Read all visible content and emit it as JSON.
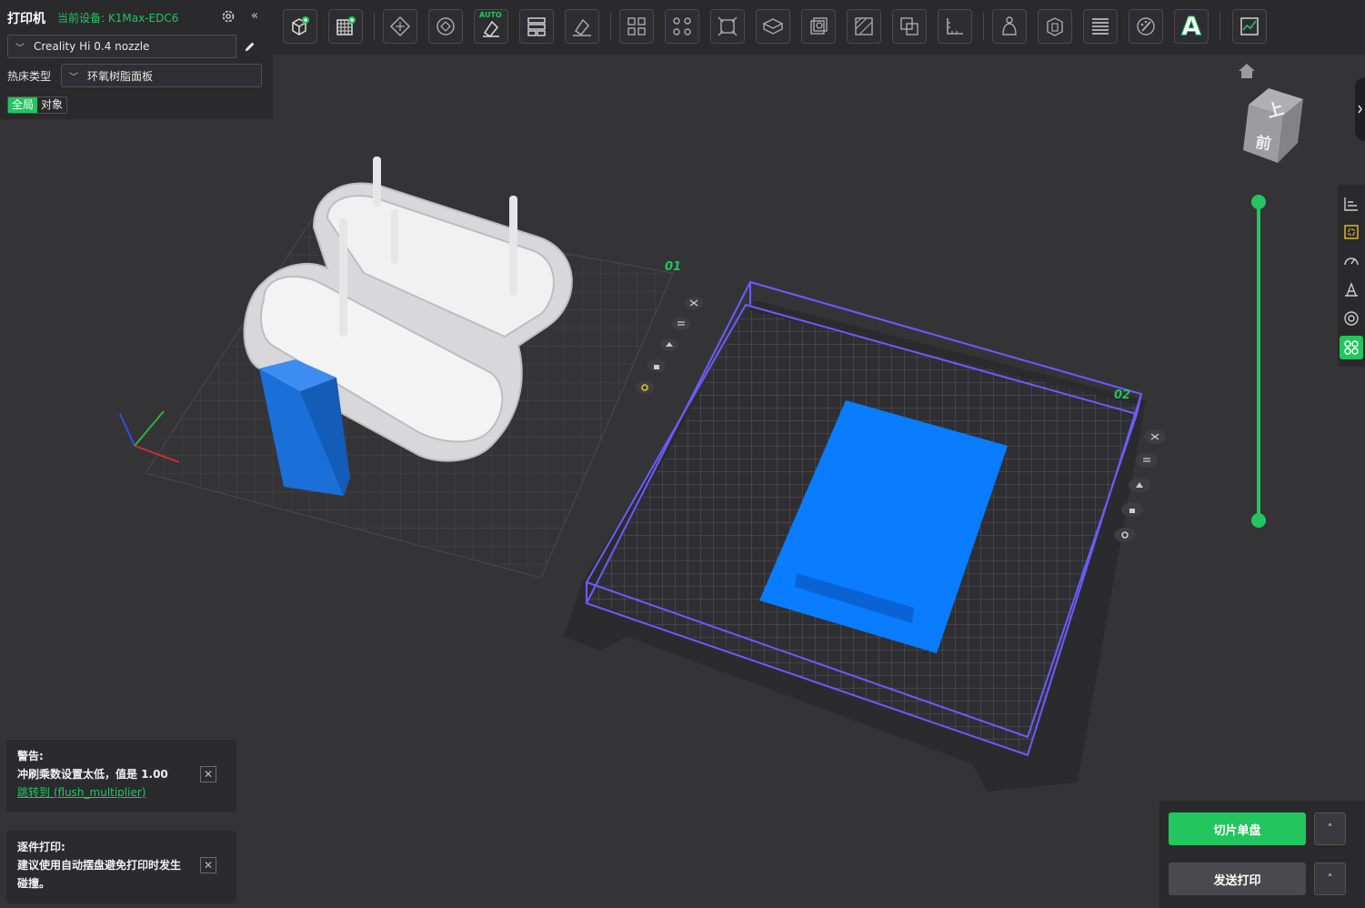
{
  "printer_panel": {
    "title": "打印机",
    "current_device": "当前设备: K1Max-EDC6",
    "collapse_glyph": "«",
    "printer_select": "Creality Hi 0.4 nozzle",
    "bed_type_label": "热床类型",
    "bed_type_value": "环氧树脂面板",
    "scope_tabs": [
      "全局",
      "对象"
    ],
    "active_scope": "全局"
  },
  "toolbar": {
    "auto_tag": "AUTO",
    "text_tool_glyph": "A",
    "icons": [
      "add-object-icon",
      "add-plate-icon",
      "arrange-icon",
      "orient-icon",
      "auto-orient-icon",
      "layout-icon",
      "lay-on-face-icon",
      "split-objects-icon",
      "split-parts-icon",
      "scale-icon",
      "hollow-icon",
      "cut-icon",
      "support-paint-icon",
      "boolean-icon",
      "measure-icon",
      "seam-paint-icon",
      "variable-layer-icon",
      "layer-icon",
      "color-paint-icon",
      "text-icon",
      "assembly-view-icon"
    ]
  },
  "plates": [
    {
      "label": "01",
      "icons": [
        "close-icon",
        "menu-icon",
        "orient-icon",
        "lock-icon",
        "settings-icon"
      ]
    },
    {
      "label": "02",
      "icons": [
        "close-icon",
        "menu-icon",
        "orient-icon",
        "lock-icon",
        "settings-icon"
      ]
    }
  ],
  "view_cube": {
    "top_face": "上",
    "front_face": "前"
  },
  "side_tools": [
    "align-icon",
    "object-list-icon",
    "speed-icon",
    "support-icon",
    "measure-icon",
    "slice-preview-icon"
  ],
  "notices": [
    {
      "title": "警告:",
      "body": "冲刷乘数设置太低，值是 1.00",
      "link": "跳转到 (flush_multiplier)"
    },
    {
      "title": "逐件打印:",
      "body_line1": "建议使用自动摆盘避免打印时发生",
      "body_line2": "碰撞。"
    }
  ],
  "actions": {
    "slice_label": "切片单盘",
    "send_label": "发送打印",
    "caret": "˄"
  },
  "colors": {
    "accent": "#22c55e",
    "plate_frame": "#6b5cff",
    "part_blue": "#0a7cff",
    "background": "#343437"
  }
}
